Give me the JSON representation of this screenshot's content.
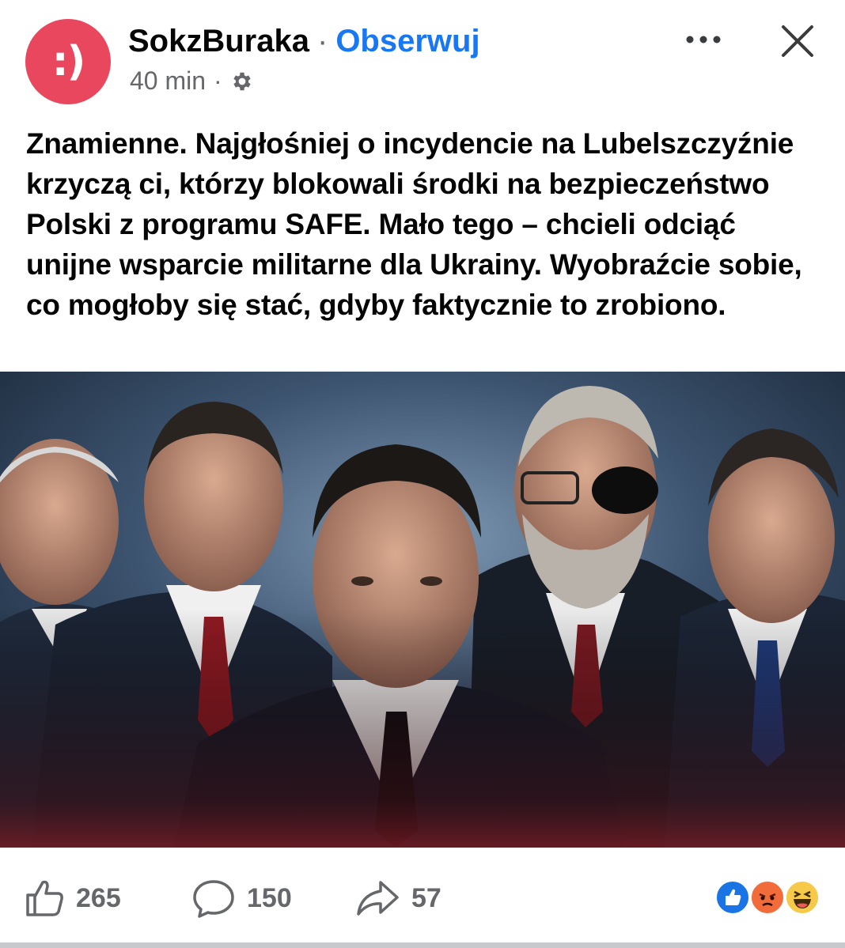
{
  "post": {
    "author": "SokzBuraka",
    "follow_label": "Obserwuj",
    "avatar_text": ":)",
    "time": "40 min",
    "separator": "·",
    "text": "Znamienne. Najgłośniej o incydencie na Lubelszczyźnie krzyczą ci, którzy blokowali środki na bezpieczeństwo Polski z programu SAFE. Mało tego – chcieli odciąć unijne wsparcie militarne dla Ukrainy. Wyobraźcie sobie, co mogłoby się stać, gdyby faktycznie to zrobiono."
  },
  "icons": {
    "audience": "gear-icon",
    "more": "more-icon",
    "close": "close-icon",
    "like": "thumbs-up-icon",
    "comment": "comment-bubble-icon",
    "share": "share-arrow-icon"
  },
  "footer": {
    "likes": "265",
    "comments": "150",
    "shares": "57",
    "reactions": [
      "like-reaction",
      "angry-reaction",
      "haha-reaction"
    ]
  },
  "colors": {
    "avatar_bg": "#e8475d",
    "follow": "#1877f2",
    "muted": "#65676b",
    "text": "#050505"
  }
}
